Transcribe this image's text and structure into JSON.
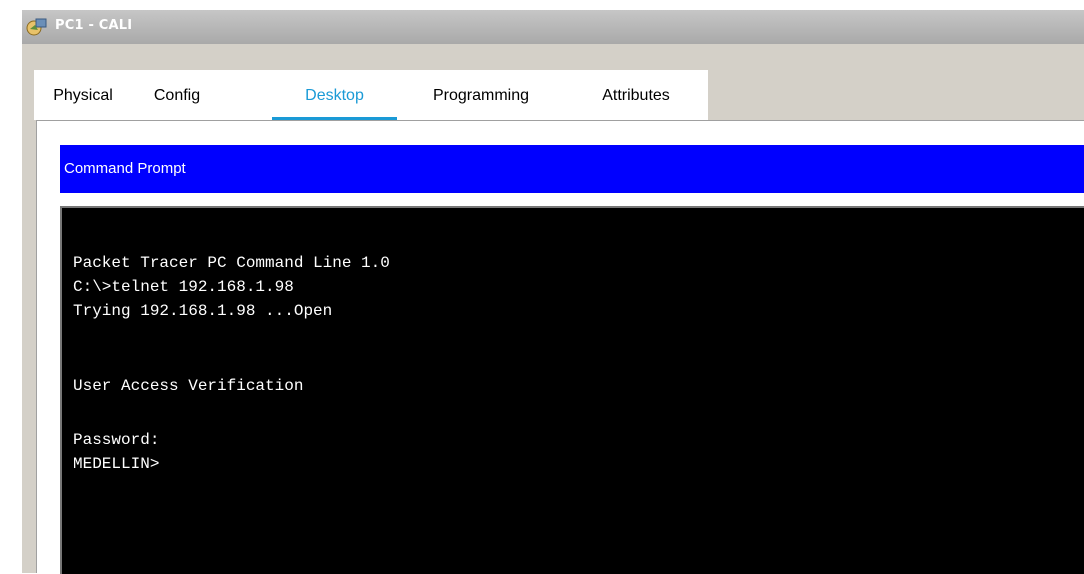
{
  "window": {
    "title": "PC1 - CALI"
  },
  "tabs": [
    {
      "label": "Physical"
    },
    {
      "label": "Config"
    },
    {
      "label": "Desktop"
    },
    {
      "label": "Programming"
    },
    {
      "label": "Attributes"
    }
  ],
  "active_tab": "Desktop",
  "command_prompt": {
    "title": "Command Prompt",
    "lines": [
      "Packet Tracer PC Command Line 1.0",
      "C:\\>telnet 192.168.1.98",
      "Trying 192.168.1.98 ...Open",
      "User Access Verification",
      "Password:",
      "MEDELLIN>"
    ]
  },
  "colors": {
    "active_tab_accent": "#1a9ad6",
    "header_blue": "#0000ff",
    "terminal_bg": "#000000",
    "terminal_text": "#ffffff"
  },
  "icons": {
    "app_icon": "pc-app-icon"
  }
}
